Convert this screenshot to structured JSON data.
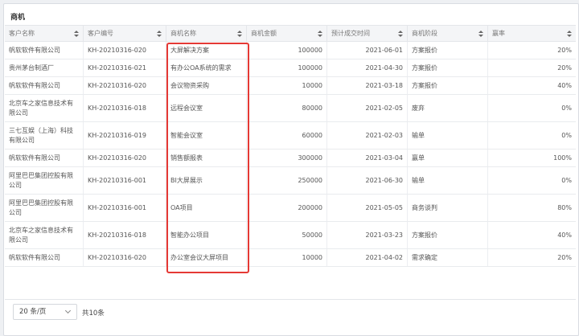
{
  "card": {
    "title": "商机"
  },
  "table": {
    "columns": [
      {
        "label": "客户名称"
      },
      {
        "label": "客户编号"
      },
      {
        "label": "商机名称"
      },
      {
        "label": "商机金额"
      },
      {
        "label": "预计成交时间"
      },
      {
        "label": "商机阶段"
      },
      {
        "label": "赢率"
      }
    ],
    "rows": [
      {
        "customer": "帆软软件有限公司",
        "code": "KH-20210316-020",
        "name": "大屏解决方案",
        "amount": "100000",
        "date": "2021-06-01",
        "stage": "方案报价",
        "rate": "20%"
      },
      {
        "customer": "贵州茅台制酒厂",
        "code": "KH-20210316-021",
        "name": "有办公OA系统的需求",
        "amount": "100000",
        "date": "2021-04-30",
        "stage": "方案报价",
        "rate": "20%"
      },
      {
        "customer": "帆软软件有限公司",
        "code": "KH-20210316-020",
        "name": "会议物资采购",
        "amount": "10000",
        "date": "2021-03-18",
        "stage": "方案报价",
        "rate": "40%"
      },
      {
        "customer": "北京车之家信息技术有限公司",
        "code": "KH-20210316-018",
        "name": "远程会议室",
        "amount": "80000",
        "date": "2021-02-05",
        "stage": "废弃",
        "rate": "0%"
      },
      {
        "customer": "三七互娱（上海）科技有限公司",
        "code": "KH-20210316-019",
        "name": "智能会议室",
        "amount": "60000",
        "date": "2021-02-03",
        "stage": "输单",
        "rate": "0%"
      },
      {
        "customer": "帆软软件有限公司",
        "code": "KH-20210316-020",
        "name": "销售额报表",
        "amount": "300000",
        "date": "2021-03-04",
        "stage": "赢单",
        "rate": "100%"
      },
      {
        "customer": "阿里巴巴集团控股有限公司",
        "code": "KH-20210316-001",
        "name": "BI大屏展示",
        "amount": "250000",
        "date": "2021-06-30",
        "stage": "输单",
        "rate": "0%"
      },
      {
        "customer": "阿里巴巴集团控股有限公司",
        "code": "KH-20210316-001",
        "name": "OA项目",
        "amount": "200000",
        "date": "2021-05-05",
        "stage": "商务谈判",
        "rate": "80%"
      },
      {
        "customer": "北京车之家信息技术有限公司",
        "code": "KH-20210316-018",
        "name": "智能办公项目",
        "amount": "50000",
        "date": "2021-03-23",
        "stage": "方案报价",
        "rate": "40%"
      },
      {
        "customer": "帆软软件有限公司",
        "code": "KH-20210316-020",
        "name": "办公室会议大屏项目",
        "amount": "10000",
        "date": "2021-04-02",
        "stage": "需求确定",
        "rate": "20%"
      }
    ]
  },
  "pager": {
    "page_size": "20 条/页",
    "total": "共10条"
  },
  "colors": {
    "highlight": "#e53935",
    "header_bg": "#f4f5f7"
  }
}
